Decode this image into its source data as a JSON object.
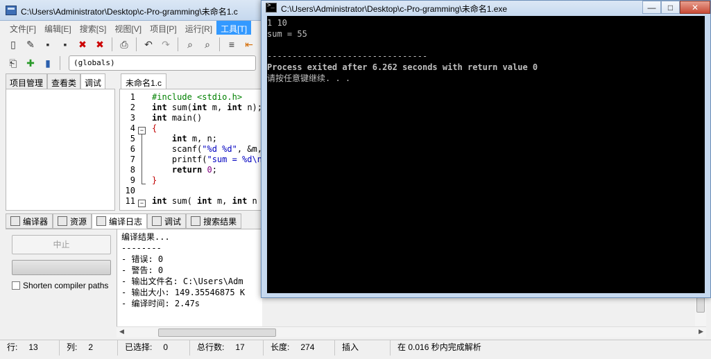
{
  "ide": {
    "title": "C:\\Users\\Administrator\\Desktop\\c-Pro-gramming\\未命名1.c",
    "menu": [
      "文件[F]",
      "编辑[E]",
      "搜索[S]",
      "视图[V]",
      "项目[P]",
      "运行[R]",
      "工具[T]"
    ],
    "globals_select": "(globals)",
    "left_tabs": [
      "项目管理",
      "查看类",
      "调试"
    ],
    "editor_tab": "未命名1.c",
    "line_numbers": [
      "1",
      "2",
      "3",
      "4",
      "5",
      "6",
      "7",
      "8",
      "9",
      "10",
      "11"
    ],
    "bottom_tabs": [
      "编译器",
      "资源",
      "编译日志",
      "调试",
      "搜索结果"
    ],
    "stop_button": "中止",
    "shorten_checkbox": "Shorten compiler paths",
    "log_lines": [
      "编译结果...",
      "--------",
      "- 错误: 0",
      "- 警告: 0",
      "- 输出文件名: C:\\Users\\Adm",
      "- 输出大小: 149.35546875 K",
      "- 编译时间: 2.47s"
    ],
    "status": {
      "line_label": "行:",
      "line_value": "13",
      "col_label": "列:",
      "col_value": "2",
      "sel_label": "已选择:",
      "sel_value": "0",
      "total_label": "总行数:",
      "total_value": "17",
      "len_label": "长度:",
      "len_value": "274",
      "mode": "插入",
      "parse": "在 0.016 秒内完成解析"
    }
  },
  "console": {
    "title": "C:\\Users\\Administrator\\Desktop\\c-Pro-gramming\\未命名1.exe",
    "lines": [
      "1 10",
      "sum = 55",
      "",
      "--------------------------------",
      "Process exited after 6.262 seconds with return value 0",
      "请按任意键继续. . ."
    ],
    "btn_min": "—",
    "btn_max": "□",
    "btn_close": "✕"
  }
}
